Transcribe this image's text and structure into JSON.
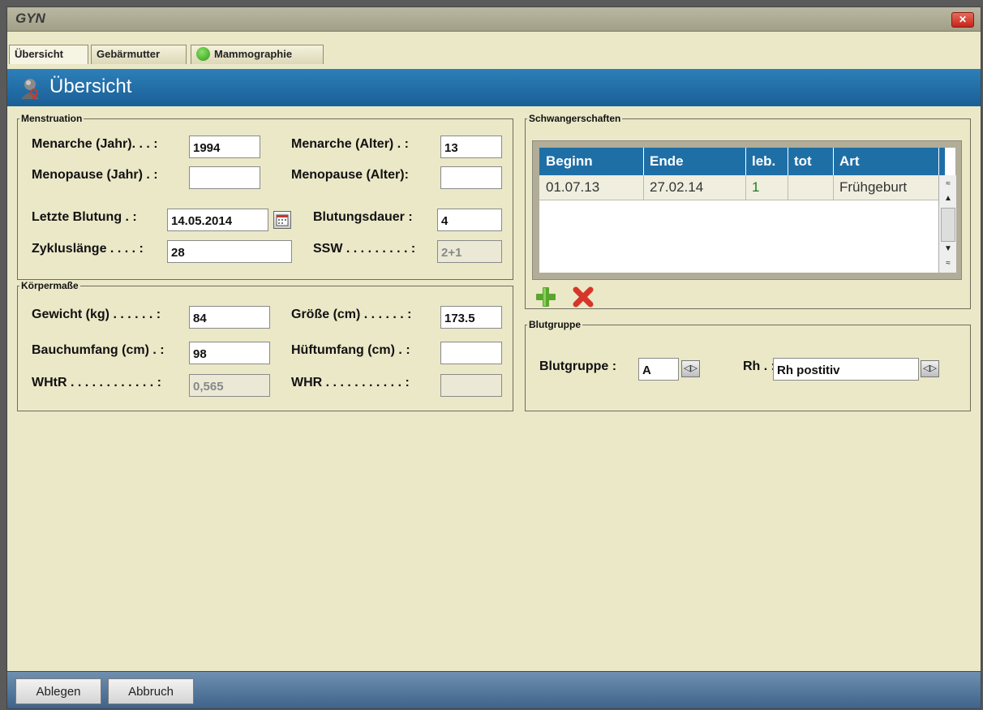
{
  "window": {
    "title": "GYN",
    "close_glyph": "✕"
  },
  "tabs": [
    {
      "label": "Übersicht",
      "active": true
    },
    {
      "label": "Gebärmutter"
    },
    {
      "label": "Mammographie",
      "status_color": "#2e9d14"
    }
  ],
  "banner": {
    "title": "Übersicht",
    "icon": "patient-icon",
    "color": "#1f6fa7"
  },
  "menstruation": {
    "legend": "Menstruation",
    "menarche_jahr_label": "Menarche (Jahr). . . :",
    "menarche_jahr_value": "1994",
    "menarche_alter_label": "Menarche (Alter) . :",
    "menarche_alter_value": "13",
    "menopause_jahr_label": "Menopause (Jahr) . :",
    "menopause_jahr_value": "",
    "menopause_alter_label": "Menopause (Alter):",
    "menopause_alter_value": "",
    "letzte_blutung_label": "Letzte Blutung . :",
    "letzte_blutung_value": "14.05.2014",
    "blutungsdauer_label": "Blutungsdauer :",
    "blutungsdauer_value": "4",
    "zykluslaenge_label": "Zykluslänge . . . . :",
    "zykluslaenge_value": "28",
    "ssw_label": "SSW . . . . . . . . . :",
    "ssw_value": "2+1"
  },
  "koerpermasse": {
    "legend": "Körpermaße",
    "gewicht_label": "Gewicht (kg) . . . . . . :",
    "gewicht_value": "84",
    "groesse_label": "Größe (cm) . . . . . . :",
    "groesse_value": "173.5",
    "bauchumfang_label": "Bauchumfang (cm) . :",
    "bauchumfang_value": "98",
    "hueftumfang_label": "Hüftumfang (cm) . :",
    "hueftumfang_value": "",
    "whtr_label": "WHtR . . . . . . . . . . . . :",
    "whtr_value": "0,565",
    "whr_label": "WHR . . . . . . . . . . . :",
    "whr_value": ""
  },
  "schwangerschaften": {
    "legend": "Schwangerschaften",
    "columns": [
      "Beginn",
      "Ende",
      "leb.",
      "tot",
      "Art"
    ],
    "rows": [
      {
        "beginn": "01.07.13",
        "ende": "27.02.14",
        "leb": "1",
        "tot": "",
        "art": "Frühgeburt"
      }
    ],
    "scroll_glyphs": {
      "top": "≈",
      "up": "▲",
      "down": "▼",
      "bottom": "≈"
    },
    "add_icon": "plus-icon",
    "delete_icon": "delete-x-icon"
  },
  "blutgruppe": {
    "legend": "Blutgruppe",
    "blutgruppe_label": "Blutgruppe :",
    "blutgruppe_value": "A",
    "rh_label": "Rh . :",
    "rh_value": "Rh postitiv",
    "spin_glyph": "◁▷"
  },
  "footer": {
    "ablegen_label": "Ablegen",
    "abbruch_label": "Abbruch"
  }
}
